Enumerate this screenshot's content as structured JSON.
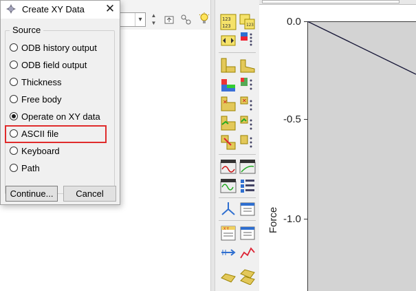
{
  "dialog": {
    "title": "Create XY Data",
    "close_symbol": "✕",
    "group_title": "Source",
    "options": [
      {
        "label": "ODB history output",
        "selected": false
      },
      {
        "label": "ODB field output",
        "selected": false
      },
      {
        "label": "Thickness",
        "selected": false
      },
      {
        "label": "Free body",
        "selected": false
      },
      {
        "label": "Operate on XY data",
        "selected": true
      },
      {
        "label": "ASCII file",
        "selected": false
      },
      {
        "label": "Keyboard",
        "selected": false
      },
      {
        "label": "Path",
        "selected": false
      }
    ],
    "continue_label": "Continue...",
    "cancel_label": "Cancel",
    "highlight_color": "#e02b2b"
  },
  "plot": {
    "ytitle": "Force",
    "yticks": [
      "0.0",
      "-0.5",
      "-1.0"
    ],
    "background": "#d3d3d3"
  },
  "toolbox": {
    "tools": [
      "xy-data-manager-icon",
      "xy-data-options-icon",
      "xy-plot-icon",
      "xy-dock-icon",
      "field-output-icon",
      "contour-options-icon",
      "path-plot-icon",
      "path-options-icon",
      "stream-icon",
      "stream-options-icon",
      "copy-xy-icon",
      "xy-list-icon",
      "animate-scale-icon",
      "animate-time-icon",
      "animate-harmonic-icon",
      "animation-options-icon",
      "view-cut-icon",
      "report-icon",
      "xy-table-icon",
      "table-options-icon",
      "free-body-icon",
      "path-create-icon",
      "display-group-icon",
      "overlay-icon"
    ]
  }
}
